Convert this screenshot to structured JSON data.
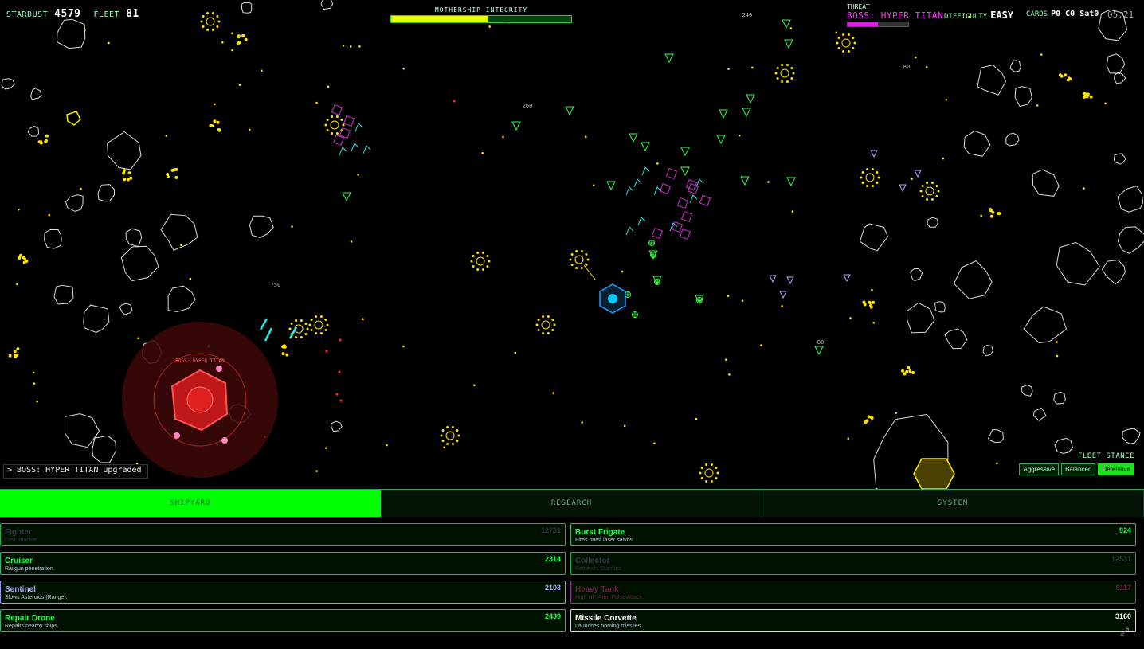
{
  "hud": {
    "stardust_label": "STARDUST",
    "stardust_value": "4579",
    "fleet_label": "FLEET",
    "fleet_value": "81",
    "integrity_label": "MOTHERSHIP INTEGRITY",
    "integrity_fraction": 0.54,
    "threat_label": "THREAT",
    "threat_value": "BOSS: HYPER TITAN",
    "threat_fraction": 0.5,
    "difficulty_label": "DIFFICULTY",
    "difficulty_value": "EASY",
    "cards_label": "CARDS",
    "cards_value": "P0 C0 Sat0",
    "clock": "05:21"
  },
  "world": {
    "boss_label": "BOSS: HYPER TITAN",
    "damage_numbers": [
      "260",
      "750",
      "240",
      "80",
      "80"
    ]
  },
  "log": {
    "message": "> BOSS: HYPER TITAN upgraded ..."
  },
  "stance": {
    "title": "FLEET STANCE",
    "options": [
      "Aggressive",
      "Balanced",
      "Defensive"
    ],
    "active": "Defensive"
  },
  "tabs": [
    {
      "label": "SHIPYARD",
      "active": true
    },
    {
      "label": "RESEARCH",
      "active": false
    },
    {
      "label": "SYSTEM",
      "active": false
    }
  ],
  "units": [
    {
      "name": "Fighter",
      "desc": "Fast attacker.",
      "cost": "12731",
      "style": "dim"
    },
    {
      "name": "Burst Frigate",
      "desc": "Fires burst laser salvos.",
      "cost": "924",
      "style": "green"
    },
    {
      "name": "Cruiser",
      "desc": "Railgun penetration.",
      "cost": "2314",
      "style": "green"
    },
    {
      "name": "Collector",
      "desc": "Retrieves Stardust.",
      "cost": "12531",
      "style": "dim"
    },
    {
      "name": "Sentinel",
      "desc": "Slows Asteroids (Range).",
      "cost": "2103",
      "style": "blue"
    },
    {
      "name": "Heavy Tank",
      "desc": "High HP, Area Pulse Attack.",
      "cost": "8117",
      "style": "purple"
    },
    {
      "name": "Repair Drone",
      "desc": "Repairs nearby ships.",
      "cost": "2439",
      "style": "green"
    },
    {
      "name": "Missile Corvette",
      "desc": "Launches homing missiles.",
      "cost": "3160",
      "style": "white"
    }
  ],
  "colors": {
    "accent": "#00ff00",
    "threat": "#ff3cff",
    "integrity_fill": "#e6ff00",
    "boss": "#ff3333"
  }
}
